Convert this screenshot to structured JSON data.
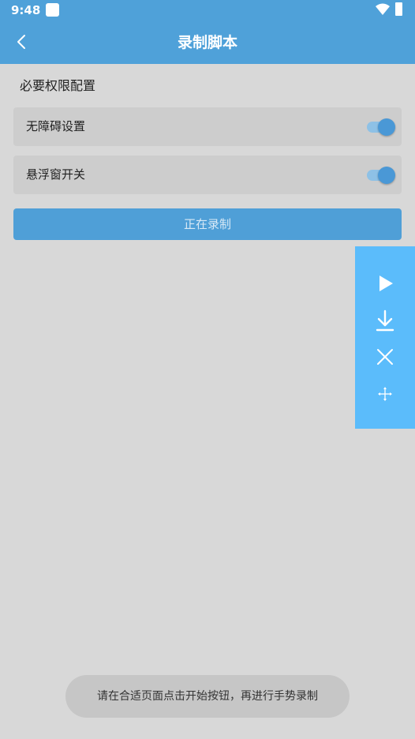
{
  "status_bar": {
    "time": "9:48",
    "notification_icon": "app-notification-icon",
    "wifi_icon": "wifi-icon",
    "battery_icon": "battery-icon"
  },
  "app_bar": {
    "back_icon": "chevron-left-icon",
    "title": "录制脚本",
    "color": "#4fa1d9"
  },
  "section": {
    "title": "必要权限配置"
  },
  "settings": [
    {
      "label": "无障碍设置",
      "enabled": true
    },
    {
      "label": "悬浮窗开关",
      "enabled": true
    }
  ],
  "record_button": {
    "label": "正在录制"
  },
  "floating_panel": {
    "color": "#5bbcfb",
    "buttons": [
      "play-icon",
      "download-icon",
      "close-icon",
      "move-icon"
    ]
  },
  "toast": {
    "message": "请在合适页面点击开始按钮，再进行手势录制"
  }
}
